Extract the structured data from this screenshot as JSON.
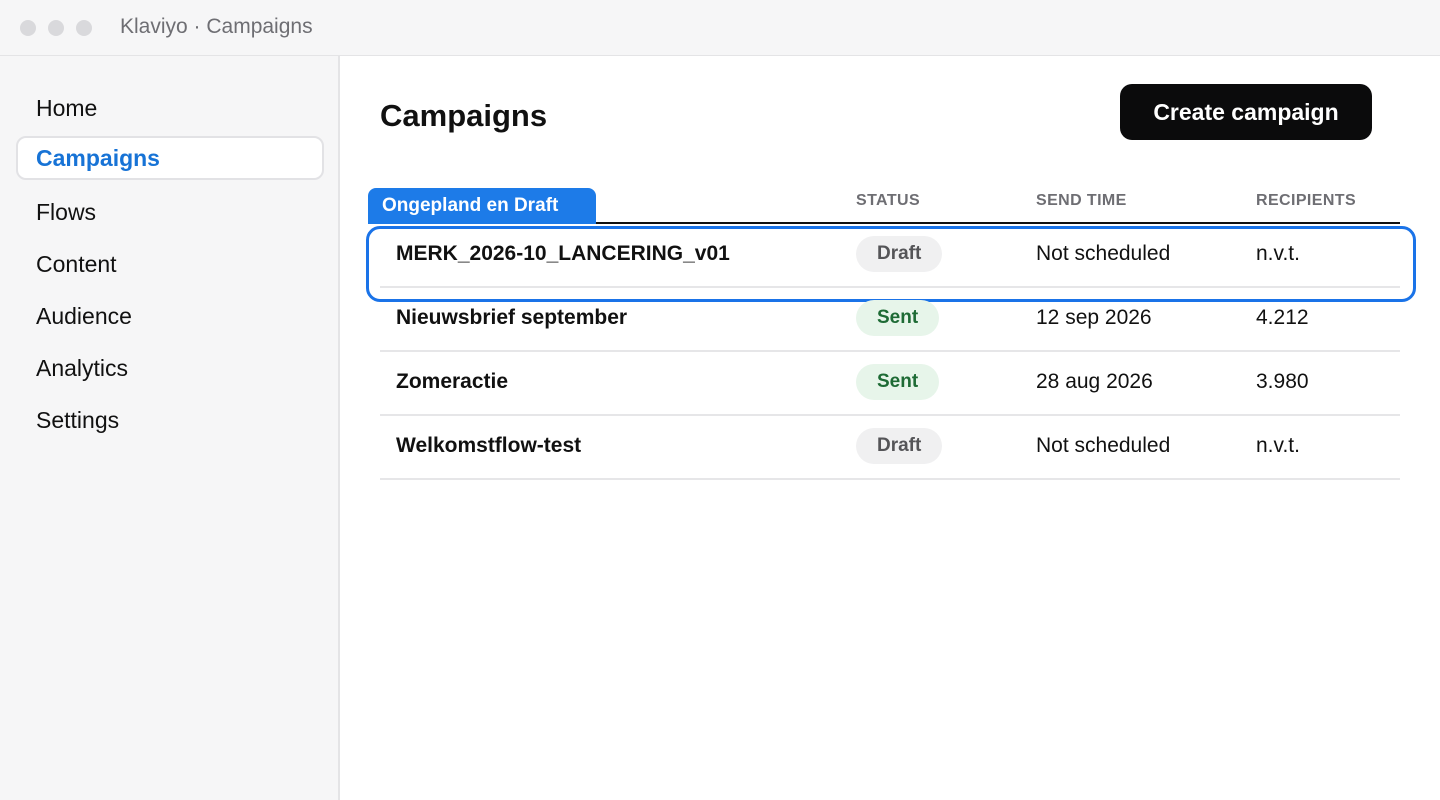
{
  "window": {
    "title": "Klaviyo · Campaigns"
  },
  "sidebar": {
    "items": [
      {
        "label": "Home",
        "active": false
      },
      {
        "label": "Campaigns",
        "active": true
      },
      {
        "label": "Flows",
        "active": false
      },
      {
        "label": "Content",
        "active": false
      },
      {
        "label": "Audience",
        "active": false
      },
      {
        "label": "Analytics",
        "active": false
      },
      {
        "label": "Settings",
        "active": false
      }
    ]
  },
  "main": {
    "title": "Campaigns",
    "create_button": "Create campaign",
    "filter_chip": "Ongepland en Draft",
    "columns": {
      "status": "STATUS",
      "send_time": "SEND TIME",
      "recipients": "RECIPIENTS"
    },
    "rows": [
      {
        "name": "MERK_2026-10_LANCERING_v01",
        "status": "Draft",
        "send_time": "Not scheduled",
        "recipients": "n.v.t.",
        "selected": true
      },
      {
        "name": "Nieuwsbrief september",
        "status": "Sent",
        "send_time": "12 sep 2026",
        "recipients": "4.212",
        "selected": false
      },
      {
        "name": "Zomeractie",
        "status": "Sent",
        "send_time": "28 aug 2026",
        "recipients": "3.980",
        "selected": false
      },
      {
        "name": "Welkomstflow-test",
        "status": "Draft",
        "send_time": "Not scheduled",
        "recipients": "n.v.t.",
        "selected": false
      }
    ]
  },
  "colors": {
    "accent": "#1773d6",
    "selection_outline": "#1a73e8",
    "chip": "#1d7be8",
    "primary_button": "#0b0b0c",
    "sent_badge_bg": "#e7f5ea",
    "sent_badge_text": "#1e6b35",
    "draft_badge_bg": "#f0f0f1",
    "draft_badge_text": "#555558"
  }
}
